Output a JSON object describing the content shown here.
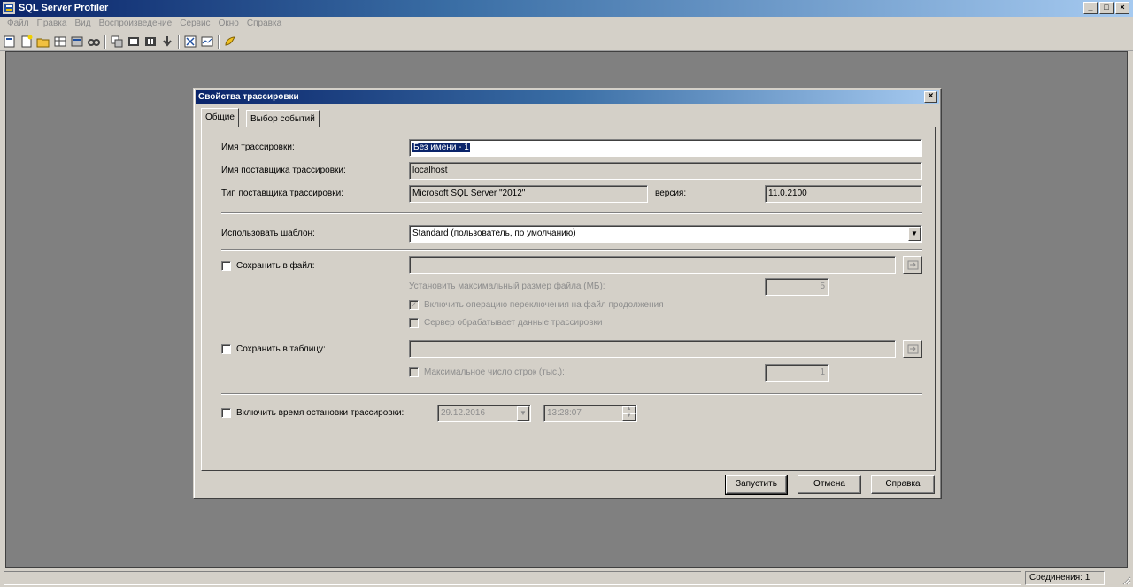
{
  "app": {
    "title": "SQL Server Profiler"
  },
  "menu": [
    "Файл",
    "Правка",
    "Вид",
    "Воспроизведение",
    "Сервис",
    "Окно",
    "Справка"
  ],
  "window_buttons": {
    "minimize": "_",
    "maximize": "□",
    "close": "×"
  },
  "dialog": {
    "title": "Свойства трассировки",
    "close": "×",
    "tabs": [
      {
        "label": "Общие",
        "active": true
      },
      {
        "label": "Выбор событий",
        "active": false
      }
    ],
    "trace_name": {
      "label": "Имя трассировки:",
      "value": "Без имени - 1"
    },
    "provider_name": {
      "label": "Имя поставщика трассировки:",
      "value": "localhost"
    },
    "provider_type": {
      "label": "Тип поставщика трассировки:",
      "value": "Microsoft SQL Server \"2012\"",
      "version_label": "версия:",
      "version_value": "11.0.2100"
    },
    "template": {
      "label": "Использовать шаблон:",
      "value": "Standard (пользователь, по умолчанию)"
    },
    "save_file": {
      "label": "Сохранить в файл:",
      "checked": false,
      "max_size_label": "Установить максимальный размер файла (МБ):",
      "max_size_value": "5",
      "rollover_label": "Включить операцию переключения на файл продолжения",
      "rollover_checked": true,
      "server_label": "Сервер обрабатывает данные трассировки",
      "server_checked": false
    },
    "save_table": {
      "label": "Сохранить в таблицу:",
      "checked": false,
      "max_rows_label": "Максимальное число строк (тыс.):",
      "max_rows_value": "1"
    },
    "stop_time": {
      "label": "Включить время остановки трассировки:",
      "checked": false,
      "date": "29.12.2016",
      "time": "13:28:07"
    },
    "buttons": {
      "run": "Запустить",
      "cancel": "Отмена",
      "help": "Справка"
    }
  },
  "status": {
    "connections": "Соединения: 1"
  }
}
